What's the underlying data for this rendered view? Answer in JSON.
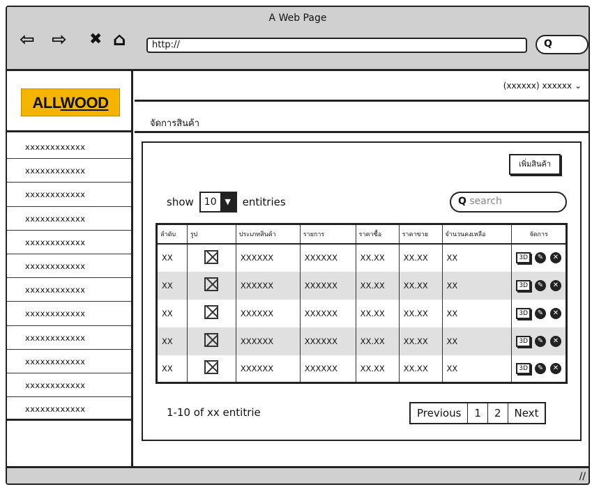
{
  "browser": {
    "title": "A Web Page",
    "url": "http://",
    "search_label": "Q",
    "nav": [
      "⇦",
      "⇨",
      "✖",
      "⌂"
    ]
  },
  "brand": {
    "part1": "ALL",
    "part2": "WOOD"
  },
  "user": {
    "label": "(xxxxxx) xxxxxx",
    "chevron": "⌄"
  },
  "breadcrumb": "จัดการสินค้า",
  "sidebar": {
    "items": [
      "xxxxxxxxxxxx",
      "xxxxxxxxxxxx",
      "xxxxxxxxxxxx",
      "xxxxxxxxxxxx",
      "xxxxxxxxxxxx",
      "xxxxxxxxxxxx",
      "xxxxxxxxxxxx",
      "xxxxxxxxxxxx",
      "xxxxxxxxxxxx",
      "xxxxxxxxxxxx",
      "xxxxxxxxxxxx",
      "xxxxxxxxxxxx"
    ]
  },
  "toolbar": {
    "add_label": "เพิ่มสินค้า"
  },
  "length": {
    "show": "show",
    "value": "10",
    "entries": "entitries"
  },
  "search": {
    "icon": "Q",
    "placeholder": "search"
  },
  "table": {
    "headers": [
      "ลำดับ",
      "รูป",
      "ประเภทสินค้า",
      "รายการ",
      "ราคาซื้อ",
      "ราคาขาย",
      "จำนวนคงเหลือ",
      "จัดการ"
    ],
    "rows": [
      [
        "XX",
        "",
        "XXXXXX",
        "XXXXXX",
        "XX.XX",
        "XX.XX",
        "XX"
      ],
      [
        "XX",
        "",
        "XXXXXX",
        "XXXXXX",
        "XX.XX",
        "XX.XX",
        "XX"
      ],
      [
        "XX",
        "",
        "XXXXXX",
        "XXXXXX",
        "XX.XX",
        "XX.XX",
        "XX"
      ],
      [
        "XX",
        "",
        "XXXXXX",
        "XXXXXX",
        "XX.XX",
        "XX.XX",
        "XX"
      ],
      [
        "XX",
        "",
        "XXXXXX",
        "XXXXXX",
        "XX.XX",
        "XX.XX",
        "XX"
      ]
    ],
    "action_3d": "3D",
    "action_edit": "✎",
    "action_delete": "✕"
  },
  "footer": {
    "count": "1-10 of xx entitrie"
  },
  "pagination": {
    "previous": "Previous",
    "page1": "1",
    "page2": "2",
    "next": "Next"
  },
  "statusbar": {
    "grip": "//"
  }
}
